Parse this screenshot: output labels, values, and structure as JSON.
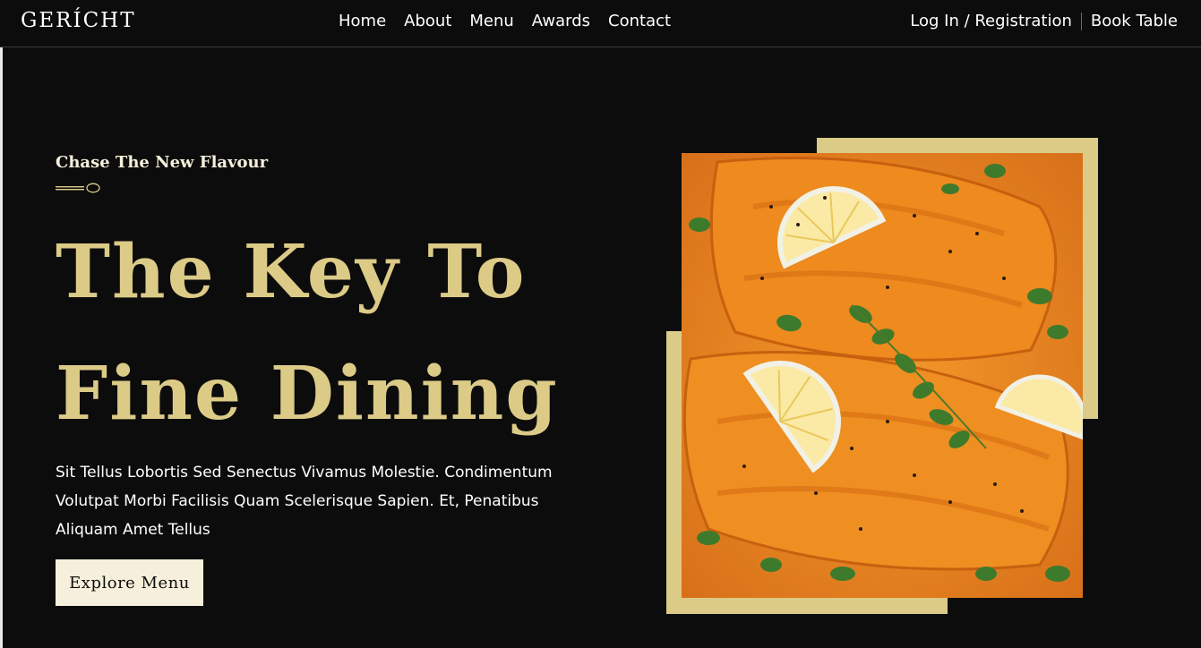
{
  "brand": {
    "logo": "GERÍCHT"
  },
  "nav": {
    "links": [
      "Home",
      "About",
      "Menu",
      "Awards",
      "Contact"
    ],
    "login": "Log In / Registration",
    "book": "Book Table"
  },
  "hero": {
    "subtitle": "Chase The New Flavour",
    "title_line1": "The Key To",
    "title_line2": "Fine Dining",
    "description": "Sit Tellus Lobortis Sed Senectus Vivamus Molestie. Condimentum Volutpat Morbi Facilisis Quam Scelerisque Sapien. Et, Penatibus Aliquam Amet Tellus",
    "button_label": "Explore Menu"
  },
  "colors": {
    "background": "#0c0c0c",
    "gold": "#dcca87",
    "cream": "#f5efdb"
  },
  "icons": {
    "divider": "spoon-icon"
  }
}
